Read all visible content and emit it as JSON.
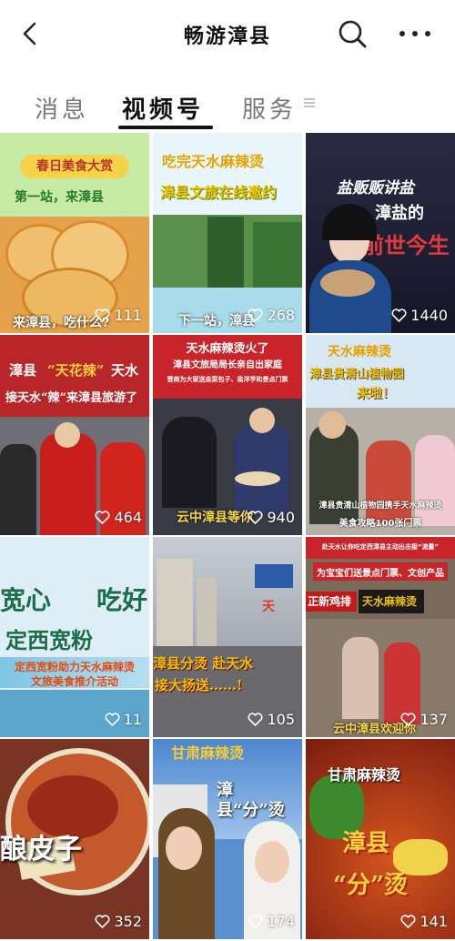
{
  "header": {
    "title": "畅游漳县"
  },
  "tabs": [
    {
      "label": "消息"
    },
    {
      "label": "视频号"
    },
    {
      "label": "服务"
    }
  ],
  "videos": [
    {
      "texts": [
        "春日美食大赏",
        "第一站，来漳县",
        "来漳县，吃什么?"
      ],
      "likes": "111"
    },
    {
      "texts": [
        "吃完天水麻辣烫",
        "漳县文旅在线邀约",
        "下一站，漳县"
      ],
      "likes": "268"
    },
    {
      "texts": [
        "盐贩贩讲盐",
        "漳盐的",
        "前世今生"
      ],
      "likes": "1440"
    },
    {
      "texts": [
        "漳县",
        "“天花辣”",
        "天水",
        "接天水“辣”来漳县旅游了"
      ],
      "likes": "464"
    },
    {
      "texts": [
        "天水麻辣烫火了",
        "漳县文旅局局长亲自出家庭",
        "晋商为大家送韭菜包子、盐洋芋和景点门票",
        "云中漳县等你"
      ],
      "likes": "940"
    },
    {
      "texts": [
        "天水麻辣烫",
        "漳县贵清山植物园",
        "来啦！",
        "漳县贵清山植物园携手天水麻辣烫",
        "美食攻略100张门票"
      ],
      "likes": ""
    },
    {
      "texts": [
        "宽心",
        "吃好",
        "定西宽粉",
        "定西宽粉助力天水麻辣烫",
        "文旅美食推介活动"
      ],
      "likes": "11"
    },
    {
      "texts": [
        "天",
        "漳县分烫 赴天水",
        "接大扬送……!"
      ],
      "likes": "105"
    },
    {
      "texts": [
        "赴天水让你吃定西漳县主动出击接“流量”",
        "为宝宝们送景点门票、文创产品",
        "正新鸡排",
        "天水麻辣烫",
        "云中漳县欢迎你"
      ],
      "likes": "137"
    },
    {
      "texts": [
        "酿皮子"
      ],
      "likes": "352"
    },
    {
      "texts": [
        "甘肃麻辣烫",
        "漳县“分”烫"
      ],
      "likes": "174"
    },
    {
      "texts": [
        "甘肃麻辣烫",
        "漳县",
        "“分”烫"
      ],
      "likes": "141"
    }
  ]
}
